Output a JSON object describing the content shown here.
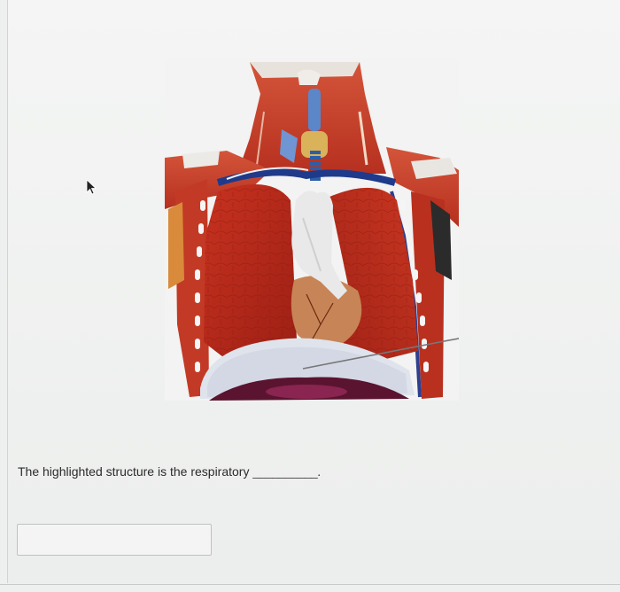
{
  "question": {
    "text": "The highlighted structure is the respiratory",
    "blank": "__________",
    "end": "."
  },
  "answer": {
    "value": ""
  },
  "image": {
    "icon": "anatomy-torso-model",
    "highlight_color": "#dfe3ec"
  }
}
